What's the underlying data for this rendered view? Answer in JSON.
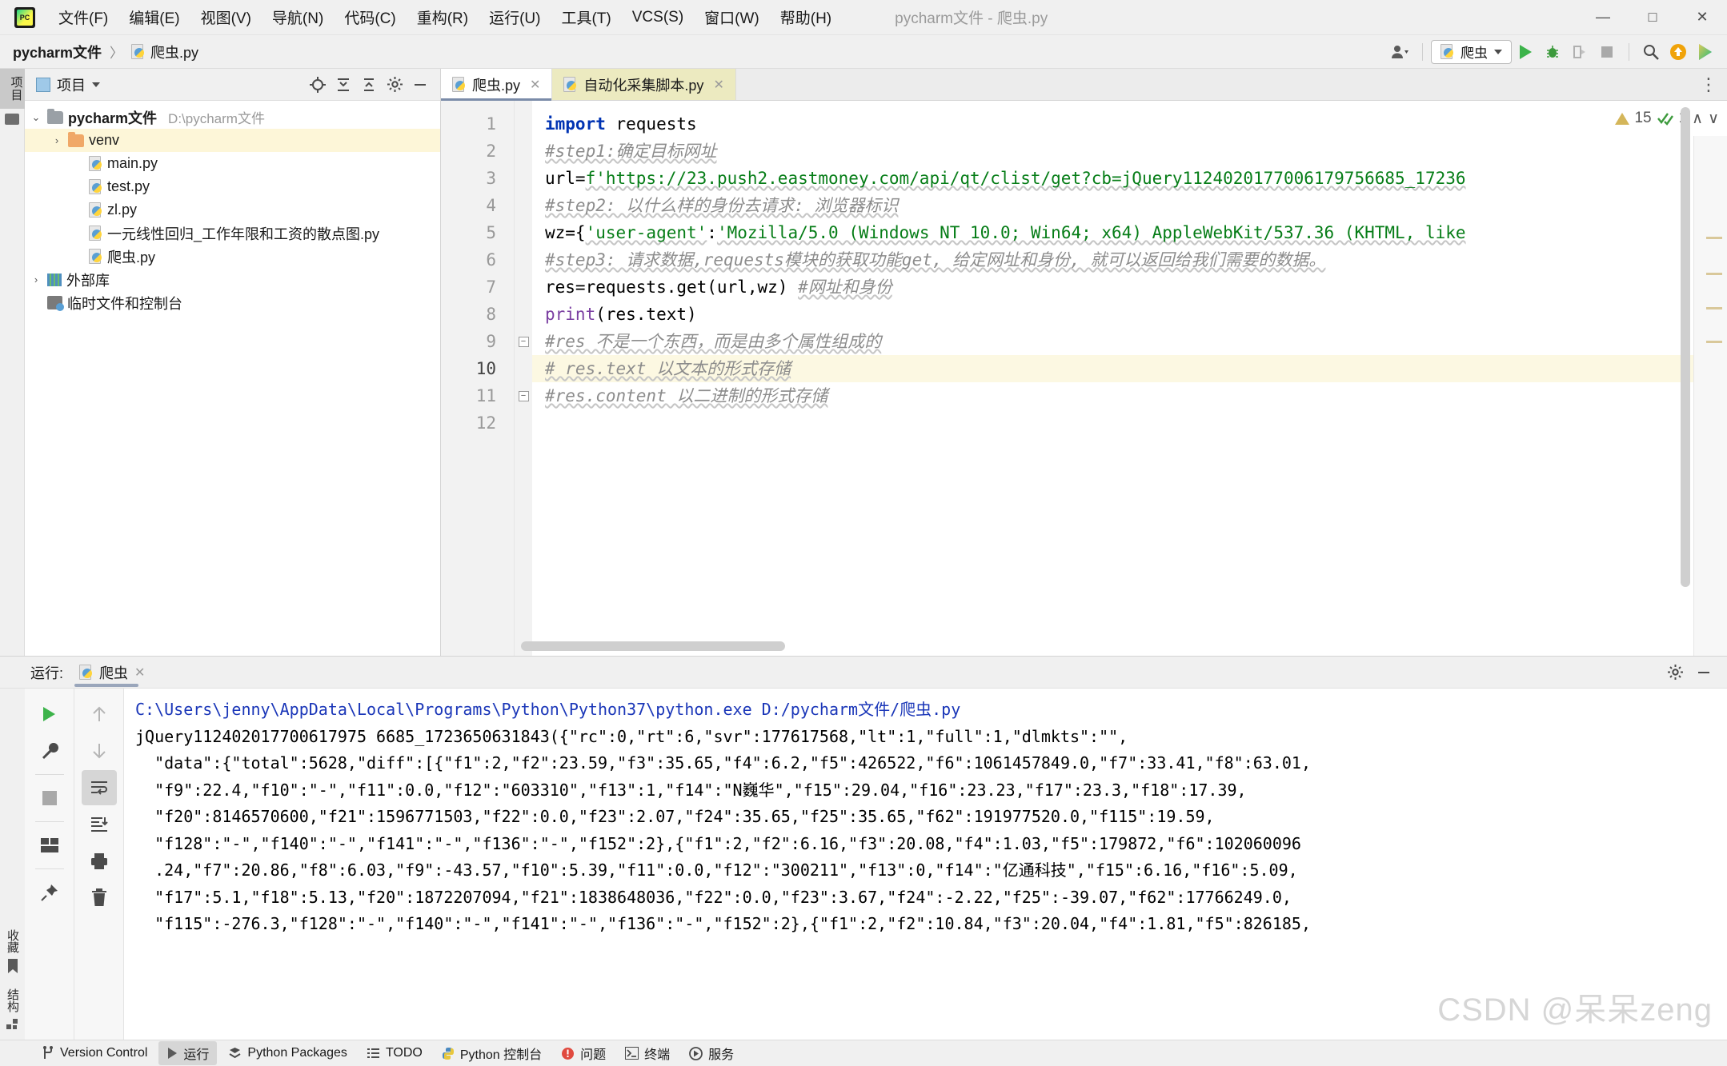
{
  "window": {
    "title": "pycharm文件 - 爬虫.py",
    "minimize_label": "—",
    "maximize_label": "□",
    "close_label": "✕"
  },
  "menu": {
    "items": [
      "文件(F)",
      "编辑(E)",
      "视图(V)",
      "导航(N)",
      "代码(C)",
      "重构(R)",
      "运行(U)",
      "工具(T)",
      "VCS(S)",
      "窗口(W)",
      "帮助(H)"
    ]
  },
  "navbar": {
    "breadcrumb_project": "pycharm文件",
    "breadcrumb_sep": "〉",
    "breadcrumb_file": "爬虫.py",
    "run_config": "爬虫",
    "icons": [
      "account-icon",
      "run-icon",
      "debug-icon",
      "coverage-icon",
      "stop-icon",
      "search-icon",
      "update-icon",
      "plugin-icon"
    ]
  },
  "left_rail": {
    "project_tab": "项目",
    "structure_tab": "结构"
  },
  "project_panel": {
    "title": "项目",
    "tools": [
      "locate-icon",
      "expand-all-icon",
      "collapse-all-icon",
      "gear-icon",
      "hide-icon"
    ],
    "tree": [
      {
        "indent": 0,
        "arrow": "⌄",
        "icon": "folder",
        "name": "pycharm文件",
        "bold": true,
        "path": "D:\\pycharm文件",
        "selected": false
      },
      {
        "indent": 1,
        "arrow": "›",
        "icon": "folder-orange",
        "name": "venv",
        "bold": false,
        "path": "",
        "selected": true
      },
      {
        "indent": 2,
        "arrow": "",
        "icon": "python",
        "name": "main.py",
        "bold": false,
        "path": "",
        "selected": false
      },
      {
        "indent": 2,
        "arrow": "",
        "icon": "python",
        "name": "test.py",
        "bold": false,
        "path": "",
        "selected": false
      },
      {
        "indent": 2,
        "arrow": "",
        "icon": "python",
        "name": "zl.py",
        "bold": false,
        "path": "",
        "selected": false
      },
      {
        "indent": 2,
        "arrow": "",
        "icon": "python",
        "name": "一元线性回归_工作年限和工资的散点图.py",
        "bold": false,
        "path": "",
        "selected": false
      },
      {
        "indent": 2,
        "arrow": "",
        "icon": "python",
        "name": "爬虫.py",
        "bold": false,
        "path": "",
        "selected": false
      },
      {
        "indent": 0,
        "arrow": "›",
        "icon": "library",
        "name": "外部库",
        "bold": false,
        "path": "",
        "selected": false
      },
      {
        "indent": 0,
        "arrow": "",
        "icon": "scratch",
        "name": "临时文件和控制台",
        "bold": false,
        "path": "",
        "selected": false
      }
    ]
  },
  "editor": {
    "tabs": [
      {
        "label": "爬虫.py",
        "active": true,
        "close": "✕"
      },
      {
        "label": "自动化采集脚本.py",
        "active": false,
        "close": "✕"
      }
    ],
    "inspection": {
      "warning_count": "15",
      "check_count": "1",
      "up": "∧",
      "down": "∨"
    },
    "line_numbers": [
      "1",
      "2",
      "3",
      "4",
      "5",
      "6",
      "7",
      "8",
      "9",
      "10",
      "11",
      "12"
    ],
    "current_line": 10,
    "lines": [
      {
        "n": 1,
        "segments": [
          {
            "t": "import",
            "c": "kw"
          },
          {
            "t": " requests",
            "c": ""
          }
        ]
      },
      {
        "n": 2,
        "segments": [
          {
            "t": "#step1:确定目标网址",
            "c": "cmt"
          }
        ]
      },
      {
        "n": 3,
        "segments": [
          {
            "t": "url=",
            "c": ""
          },
          {
            "t": "f'https://23.push2.eastmoney.com/api/qt/clist/get?cb=jQuery1124020177006179756685_17236",
            "c": "str"
          }
        ]
      },
      {
        "n": 4,
        "segments": [
          {
            "t": "#step2: 以什么样的身份去请求: 浏览器标识",
            "c": "cmt"
          }
        ]
      },
      {
        "n": 5,
        "segments": [
          {
            "t": "wz={",
            "c": ""
          },
          {
            "t": "'user-agent'",
            "c": "str"
          },
          {
            "t": ":",
            "c": ""
          },
          {
            "t": "'Mozilla/5.0 (Windows NT 10.0; Win64; x64) AppleWebKit/537.36 (KHTML, like",
            "c": "str"
          }
        ]
      },
      {
        "n": 6,
        "segments": [
          {
            "t": "#step3: 请求数据,requests模块的获取功能get, 给定网址和身份, 就可以返回给我们需要的数据。",
            "c": "cmt"
          }
        ]
      },
      {
        "n": 7,
        "segments": [
          {
            "t": "res=requests.get(url,wz) ",
            "c": ""
          },
          {
            "t": "#网址和身份",
            "c": "cmt"
          }
        ]
      },
      {
        "n": 8,
        "segments": [
          {
            "t": "print",
            "c": "fn"
          },
          {
            "t": "(res.text)",
            "c": ""
          }
        ]
      },
      {
        "n": 9,
        "segments": [
          {
            "t": "#res 不是一个东西，而是由多个属性组成的",
            "c": "cmt"
          }
        ]
      },
      {
        "n": 10,
        "segments": [
          {
            "t": "# res.text 以文本的形式存储",
            "c": "cmt"
          }
        ]
      },
      {
        "n": 11,
        "segments": [
          {
            "t": "#res.content 以二进制的形式存储",
            "c": "cmt"
          }
        ]
      },
      {
        "n": 12,
        "segments": [
          {
            "t": "",
            "c": ""
          }
        ]
      }
    ]
  },
  "run_panel": {
    "label": "运行:",
    "tab": "爬虫",
    "tab_close": "✕",
    "left_tools": [
      "rerun-icon",
      "settings-icon",
      "stop-icon",
      "layout-icon",
      "pin-icon"
    ],
    "right_tools": [
      "up-icon",
      "down-icon",
      "soft-wrap-icon",
      "scroll-to-end-icon",
      "print-icon",
      "trash-icon"
    ],
    "rail_labels": [
      "收藏",
      "结构"
    ],
    "console": [
      {
        "text": "C:\\Users\\jenny\\AppData\\Local\\Programs\\Python\\Python37\\python.exe D:/pycharm文件/爬虫.py",
        "color": "blue"
      },
      {
        "text": "jQuery112402017700617975 6685_1723650631843({\"rc\":0,\"rt\":6,\"svr\":177617568,\"lt\":1,\"full\":1,\"dlmkts\":\"\",",
        "color": "black"
      },
      {
        "text": "  \"data\":{\"total\":5628,\"diff\":[{\"f1\":2,\"f2\":23.59,\"f3\":35.65,\"f4\":6.2,\"f5\":426522,\"f6\":1061457849.0,\"f7\":33.41,\"f8\":63.01,",
        "color": "black"
      },
      {
        "text": "  \"f9\":22.4,\"f10\":\"-\",\"f11\":0.0,\"f12\":\"603310\",\"f13\":1,\"f14\":\"N巍华\",\"f15\":29.04,\"f16\":23.23,\"f17\":23.3,\"f18\":17.39,",
        "color": "black"
      },
      {
        "text": "  \"f20\":8146570600,\"f21\":1596771503,\"f22\":0.0,\"f23\":2.07,\"f24\":35.65,\"f25\":35.65,\"f62\":191977520.0,\"f115\":19.59,",
        "color": "black"
      },
      {
        "text": "  \"f128\":\"-\",\"f140\":\"-\",\"f141\":\"-\",\"f136\":\"-\",\"f152\":2},{\"f1\":2,\"f2\":6.16,\"f3\":20.08,\"f4\":1.03,\"f5\":179872,\"f6\":102060096",
        "color": "black"
      },
      {
        "text": "  .24,\"f7\":20.86,\"f8\":6.03,\"f9\":-43.57,\"f10\":5.39,\"f11\":0.0,\"f12\":\"300211\",\"f13\":0,\"f14\":\"亿通科技\",\"f15\":6.16,\"f16\":5.09,",
        "color": "black"
      },
      {
        "text": "  \"f17\":5.1,\"f18\":5.13,\"f20\":1872207094,\"f21\":1838648036,\"f22\":0.0,\"f23\":3.67,\"f24\":-2.22,\"f25\":-39.07,\"f62\":17766249.0,",
        "color": "black"
      },
      {
        "text": "  \"f115\":-276.3,\"f128\":\"-\",\"f140\":\"-\",\"f141\":\"-\",\"f136\":\"-\",\"f152\":2},{\"f1\":2,\"f2\":10.84,\"f3\":20.04,\"f4\":1.81,\"f5\":826185,",
        "color": "black"
      }
    ],
    "watermark": "CSDN @呆呆zeng"
  },
  "status_bar": {
    "items": [
      {
        "label": "Version Control",
        "icon": "branch-icon",
        "selected": false
      },
      {
        "label": "运行",
        "icon": "run-icon",
        "selected": true
      },
      {
        "label": "Python Packages",
        "icon": "packages-icon",
        "selected": false
      },
      {
        "label": "TODO",
        "icon": "todo-icon",
        "selected": false
      },
      {
        "label": "Python 控制台",
        "icon": "python-icon",
        "selected": false
      },
      {
        "label": "问题",
        "icon": "problems-icon",
        "selected": false
      },
      {
        "label": "终端",
        "icon": "terminal-icon",
        "selected": false
      },
      {
        "label": "服务",
        "icon": "services-icon",
        "selected": false
      }
    ]
  },
  "colors": {
    "accent_green": "#3cb34a",
    "keyword_blue": "#0033b3",
    "string_green": "#067d17",
    "comment_gray": "#8c8c8c",
    "selection_yellow": "#fdf6d8",
    "console_blue": "#1a36b8"
  }
}
